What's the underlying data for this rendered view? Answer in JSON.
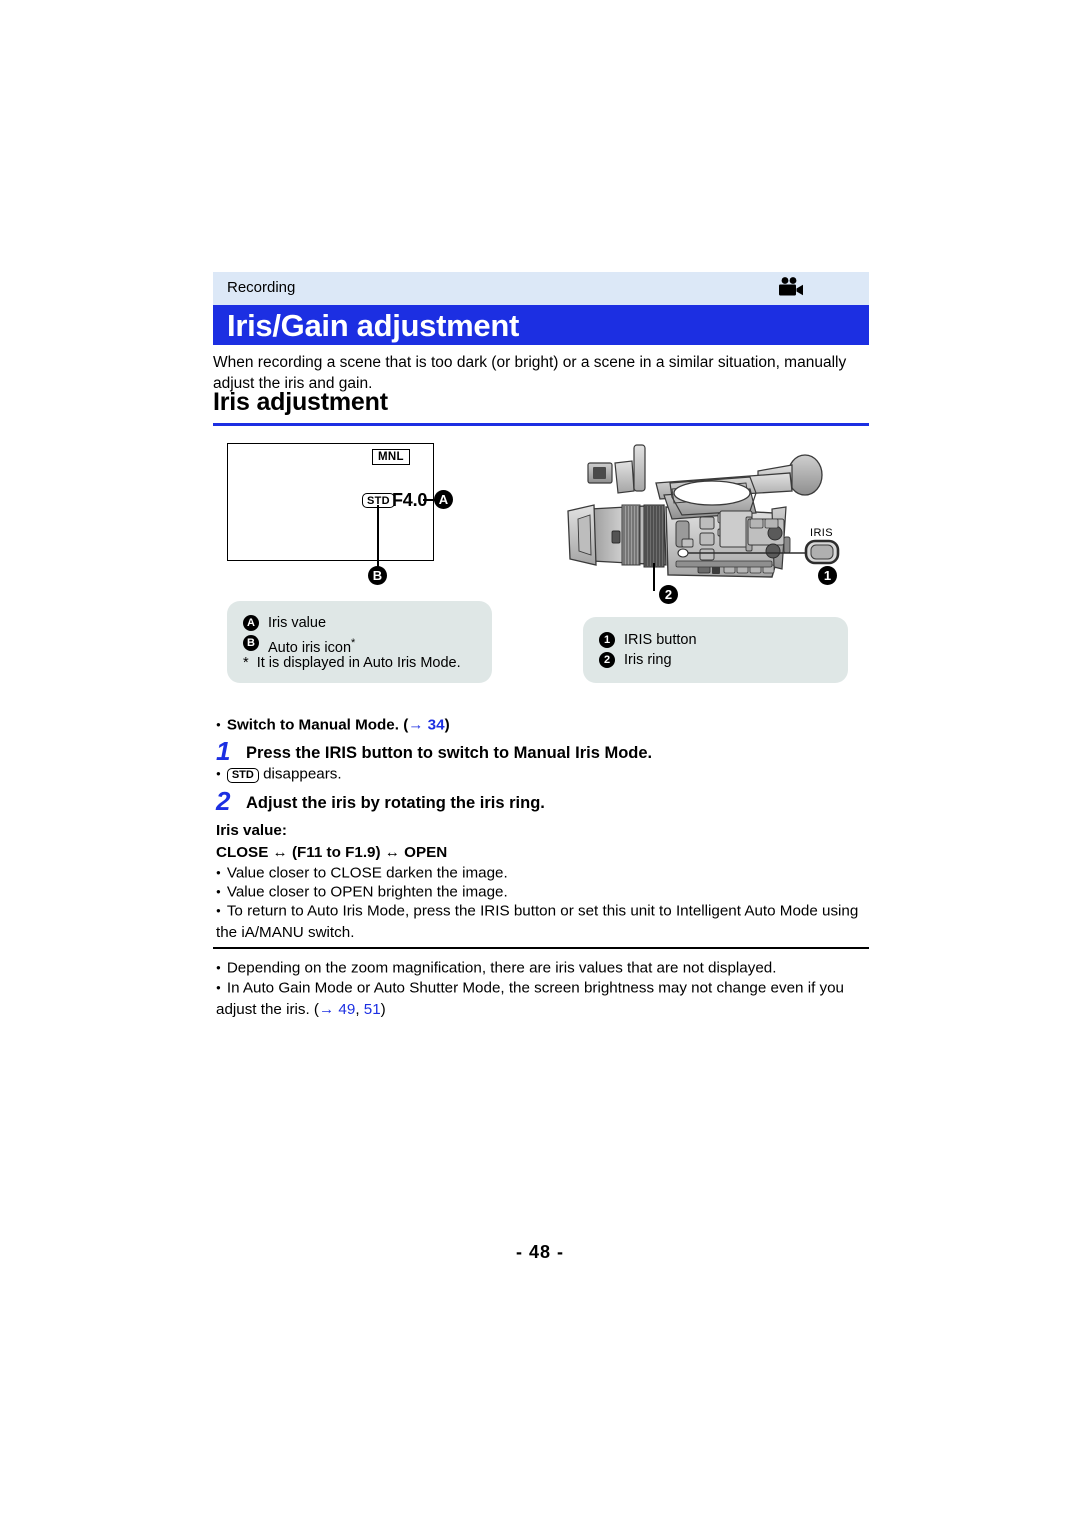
{
  "header": {
    "section_label": "Recording",
    "icon": "video-camera-icon",
    "title": "Iris/Gain adjustment",
    "band_color": "#dce8f7",
    "title_color": "#1c2fe2"
  },
  "intro": "When recording a scene that is too dark (or bright) or a scene in a similar situation, manually adjust the iris and gain.",
  "section": {
    "title": "Iris adjustment",
    "rule_color": "#1c2fe2"
  },
  "lcd": {
    "mnl_badge": "MNL",
    "std_badge": "STD",
    "iris_value": "F4.0",
    "callout_a": "A",
    "callout_b": "B"
  },
  "camera": {
    "iris_button_label": "IRIS",
    "callout_1": "1",
    "callout_2": "2"
  },
  "legend_left": {
    "rows": [
      {
        "mark": "A",
        "text": "Iris value"
      },
      {
        "mark": "B",
        "text": "Auto iris icon"
      }
    ],
    "footnote_mark": "*",
    "footnote": "It is displayed in Auto Iris Mode."
  },
  "legend_right": {
    "rows": [
      {
        "mark": "1",
        "text": "IRIS button"
      },
      {
        "mark": "2",
        "text": "Iris ring"
      }
    ]
  },
  "procedure": {
    "prereq": "Switch to Manual Mode. (",
    "prereq_arrow": "→",
    "prereq_page": "34",
    "prereq_close": ")",
    "step1_num": "1",
    "step1_text": "Press the IRIS button to switch to Manual Iris Mode.",
    "step1_note_badge": "STD",
    "step1_note_text": "disappears.",
    "step2_num": "2",
    "step2_text": "Adjust the iris by rotating the iris ring."
  },
  "iris_value": {
    "heading": "Iris value:",
    "range": "CLOSE ↔ (F11 to F1.9) ↔ OPEN",
    "bullets": [
      "Value closer to CLOSE darken the image.",
      "Value closer to OPEN brighten the image.",
      "To return to Auto Iris Mode, press the IRIS button or set this unit to Intelligent Auto Mode using the iA/MANU switch."
    ]
  },
  "notes": {
    "bullet1": "Depending on the zoom magnification, there are iris values that are not displayed.",
    "bullet2_a": "In Auto Gain Mode or Auto Shutter Mode, the screen brightness may not change even if you adjust the iris. (",
    "bullet2_arrow": "→",
    "bullet2_page_a": "49",
    "bullet2_sep": ", ",
    "bullet2_page_b": "51",
    "bullet2_close": ")"
  },
  "footer": {
    "page_number": "- 48 -"
  }
}
